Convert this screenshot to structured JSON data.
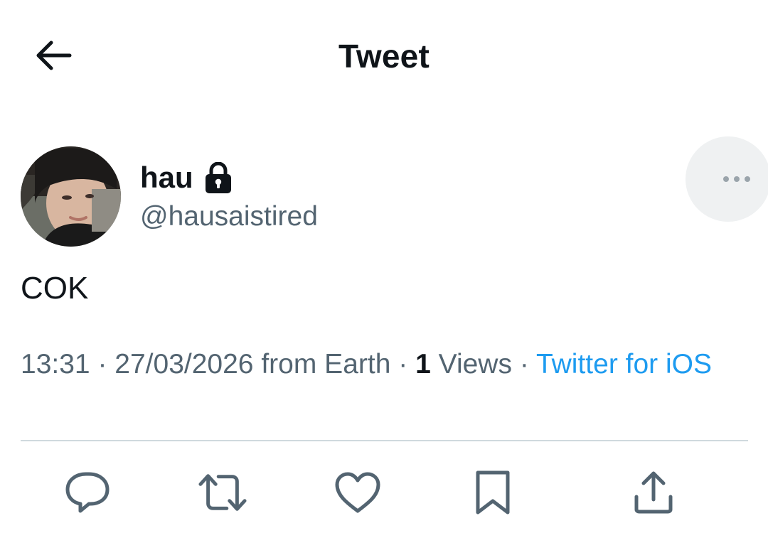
{
  "header": {
    "title": "Tweet",
    "back_icon": "arrow-left-icon"
  },
  "author": {
    "display_name": "hau",
    "handle": "@hausaistired",
    "protected_icon": "lock-icon",
    "avatar": "avatar"
  },
  "tweet": {
    "text": "COK",
    "time": "13:31",
    "date": "27/03/2026",
    "location": "from Earth",
    "views_count": "1",
    "views_label": "Views",
    "source": "Twitter for iOS",
    "separator": "·"
  },
  "actions": [
    {
      "name": "reply",
      "icon": "reply-icon"
    },
    {
      "name": "retweet",
      "icon": "retweet-icon"
    },
    {
      "name": "like",
      "icon": "heart-icon"
    },
    {
      "name": "bookmark",
      "icon": "bookmark-icon"
    },
    {
      "name": "share",
      "icon": "share-icon"
    }
  ],
  "colors": {
    "text": "#0f1419",
    "secondary": "#536471",
    "link": "#1d9bf0",
    "divider": "#cfd9de",
    "more_button_bg": "#eff1f2"
  }
}
